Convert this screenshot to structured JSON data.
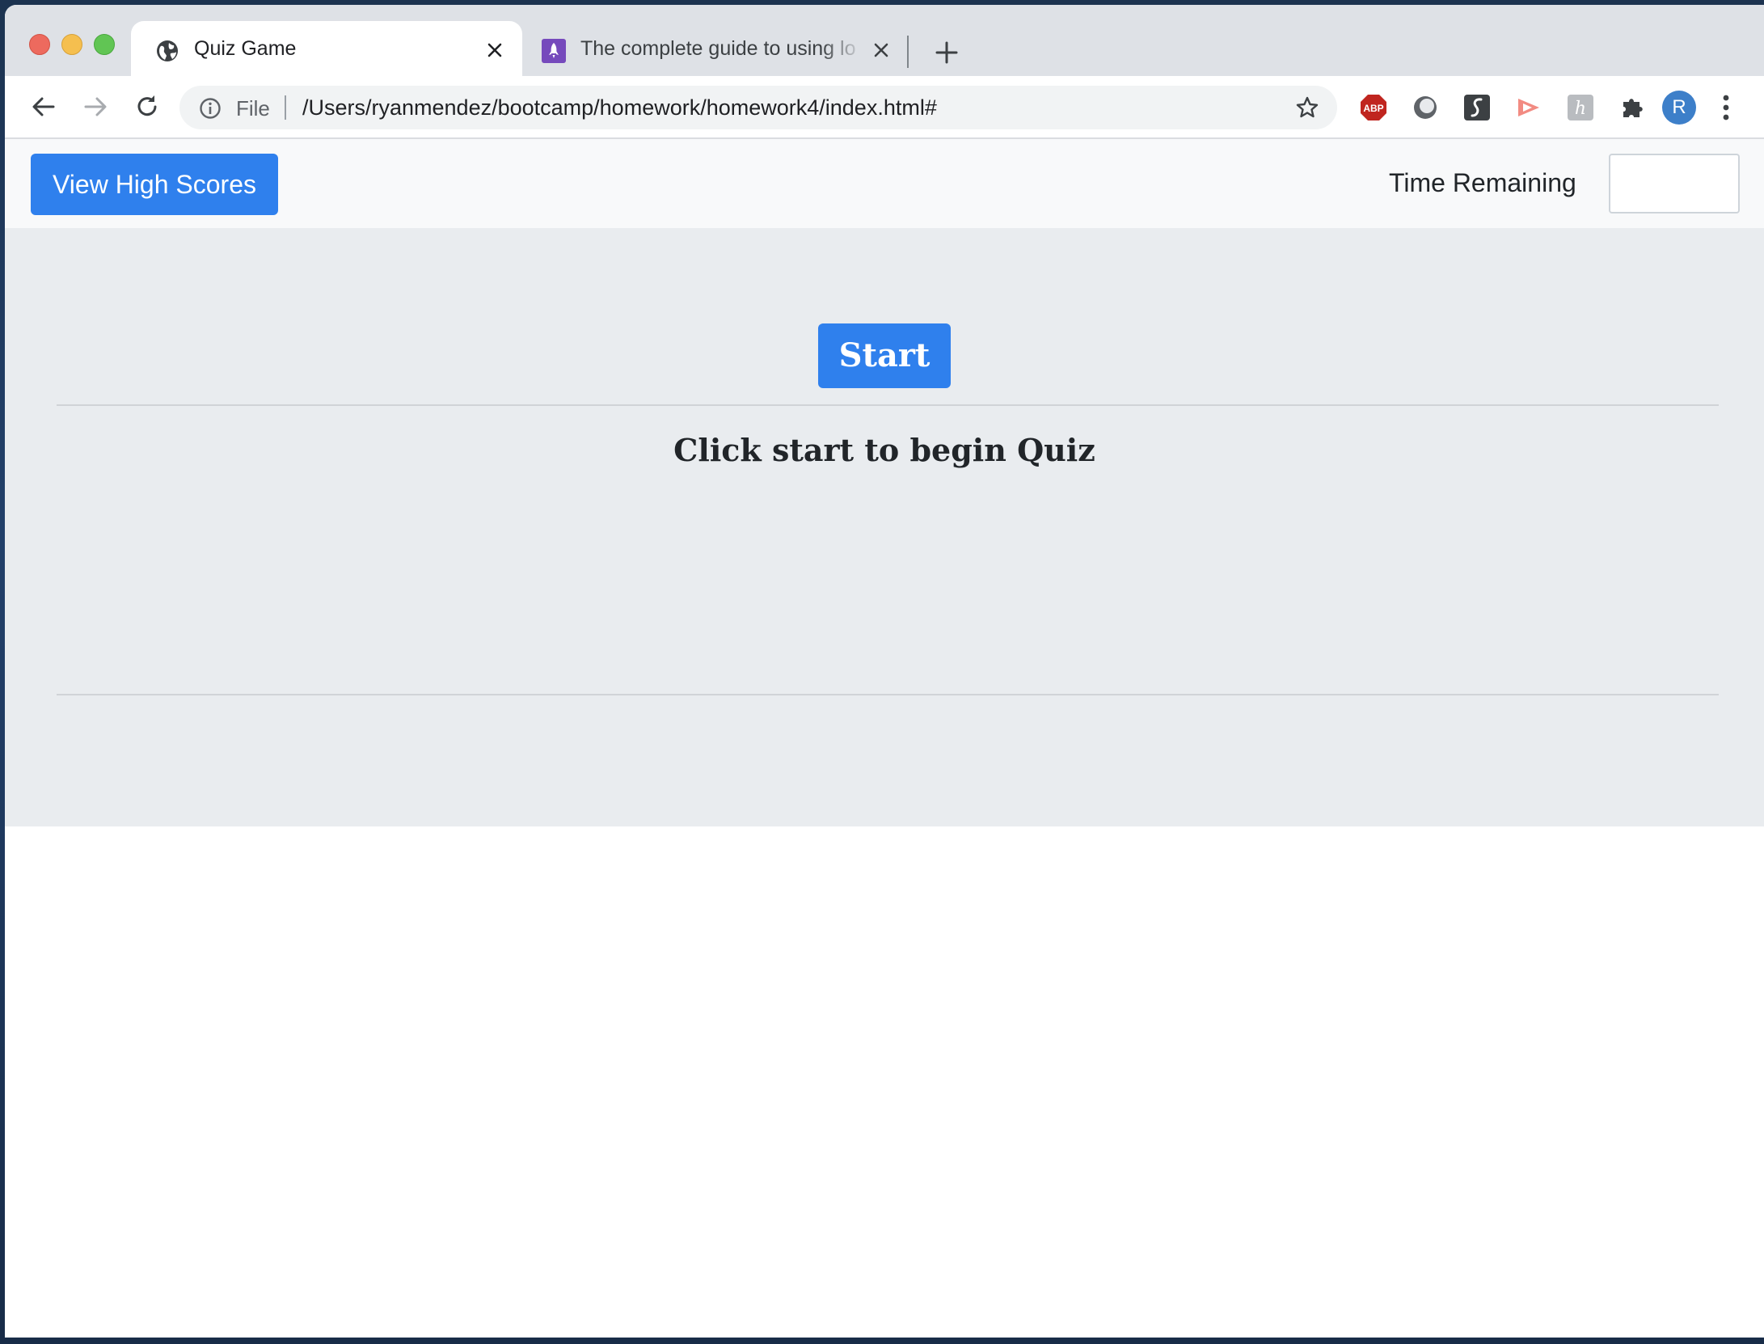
{
  "browser": {
    "tabs": [
      {
        "title": "Quiz Game",
        "favicon": "globe-icon",
        "active": true
      },
      {
        "title": "The complete guide to using lo",
        "favicon": "rocket-icon",
        "active": false
      }
    ],
    "address_bar": {
      "scheme_label": "File",
      "url": "/Users/ryanmendez/bootcamp/homework/homework4/index.html#"
    },
    "extensions": [
      "adblock-icon",
      "circle-extension-icon",
      "stylus-icon",
      "cast-icon",
      "honey-icon",
      "puzzle-icon"
    ],
    "profile_initial": "R"
  },
  "page": {
    "high_scores_label": "View High Scores",
    "time_label": "Time Remaining",
    "time_value": "",
    "start_label": "Start",
    "instruction": "Click start to begin Quiz"
  },
  "colors": {
    "primary": "#2f80ed",
    "navbar_bg": "#f8f9fa",
    "jumbotron_bg": "#e9ecef",
    "text": "#212529"
  }
}
